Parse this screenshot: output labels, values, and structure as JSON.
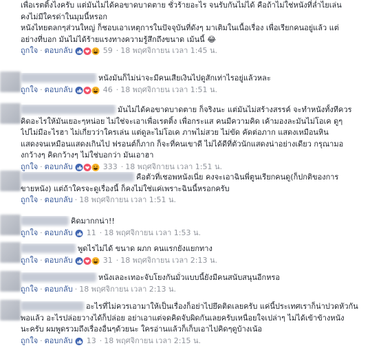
{
  "actions": {
    "like": "ถูกใจ",
    "reply": "ตอบกลับ",
    "sep": "·"
  },
  "comments": [
    {
      "lines": [
        "เพื่อเรตติ้งไงครับ แต่มันไม่ได้คอขาดบาดตาย ชั่วร้ายอะไร จนรับกันไม่ได้ คือถ้าไม่ใช่หนังที่ล่ำไยเล่น",
        "คงไม่มีใครด่าในมุมนี้หรอก",
        "หนังไทยตลกๆส่วนใหญ่ ก็ชอบเอาเหตุการในปัจจุบันที่ดังๆ มาเติมในเนื้อเรื่อง เพื่อเรียกคนอยู่แล้ว แต่",
        "อย่างที่บอก มันไม่ได้ร้ายแรงทางความรู้สึกถึงขนาด เม้นนี้ 😂"
      ],
      "count": "59",
      "time": "18 พฤศจิกายน เวลา 1:45 น."
    },
    {
      "lines": [
        "หนังมันก็ไม่น่าจะมีคนเสียเงินไปดูสักเท่าไรอยู่แล้วหละ"
      ],
      "count": "46",
      "time": "18 พฤศจิกายน เวลา 1:51 น."
    },
    {
      "lines": [
        "มันไม่ได้คอขาดบาดตาย ก็จริงนะ แต่มันไม่สร้างสรรค์ จะทำหนังทั้งทีควร",
        "คิดอะไรให้มันเยอะๆหน่อย ไม่ใช่จะเอาเพื่อเรตติ้ง เพื่อกระแส คนมีความคิด เค้ามองละมันไม่โอเค ดูๆ",
        "ไปไม่มีอะไรฮา ไม่เกี่ยวว่าใครเล่น แต่ดูละไม่โอเค ภาพไม่สวย ไม่ขัด คัดต่อภาก แสดงเหมือนหิน",
        "แสดงจนเหมือนแสดงเกินไป ฟรอนต์ก็ภาก ก็จะที่คนเขาดี ไม่ได้ดีที่ตัวนักแสดงน่าอย่างเดียว กรุณามอ",
        "งกว้างๆ คิดกว้างๆ ไม่ใช่บอกว่า มันเอาฮา"
      ],
      "count": "333",
      "time": "18 พฤศจิกายน เวลา 1:51 น."
    },
    {
      "lines": [
        "คือตัวที่เชอพหนังเนี่ย คงจะเอาฉินพี่ตูนเรียกคนดู(ก็ปกติของการ",
        "ขายหนัง) แต่ถ้าใครจะดูเรื่องนี้ ก็คงไม่ใช่แค่เพราะฉินนี้หรอกครับ"
      ],
      "count": "",
      "time": "18 พฤศจิกายน เวลา 1:51 น."
    },
    {
      "lines": [
        "คิดมากกน่า!!"
      ],
      "count": "11",
      "time": "18 พฤศจิกายน เวลา 1:53 น."
    },
    {
      "lines": [
        "พูดไรไม่ได้ ขนาด ผภก คนแรกยังแยกทาง"
      ],
      "count": "31",
      "time": "18 พฤศจิกายน เวลา 2:13 น."
    },
    {
      "lines": [
        "หนังเลอะเทอะจับโยงกันมั่วแบบนี้ยังมีคนสนับสนุนอีกหรอ"
      ],
      "count": "",
      "time": "18 พฤศจิกายน เวลา 2:13 น."
    },
    {
      "lines": [
        "อะไรที่ไม่ควรเอามาให้เป็นเรื่องก็อย่าไปยึดติดเลยครับ แค่นี้ประเทศเราก็น่าปวดหัวกัน",
        "พอแล้ว อะไรปล่อยวางได้ก็ปล่อย อย่าเอาแต่จดคิดจับผิดกันเลยครับเหนื่อยใจเปล่าๆ ไม่ได้เข้าข้างหนัง",
        "นะครับ ผมพูดรวมถึงเรื่องอื่นๆด้วยนะ ใครอ่านแล้วก็เก็บเอาไปคิดๆดูบ้างเน้อ"
      ],
      "count": "13",
      "time": "18 พฤศจิกายน เวลา 2:15 น."
    }
  ],
  "colors": {
    "link": "#365899",
    "meta": "#90949c",
    "text": "#1d2129",
    "like": "#4267b2",
    "love": "#f25268",
    "haha": "#f7b125"
  }
}
